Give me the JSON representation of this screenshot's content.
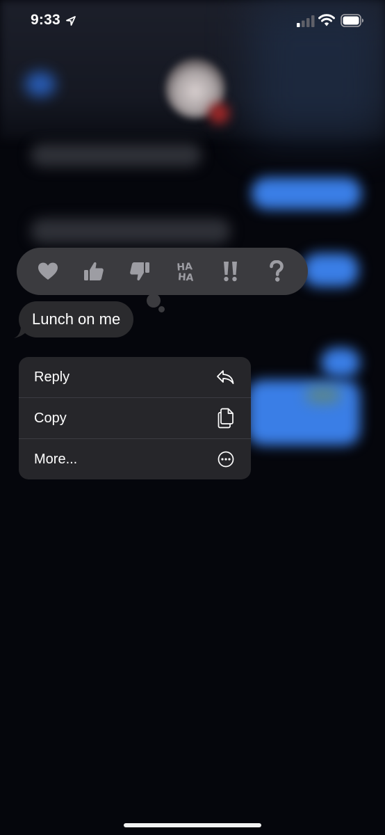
{
  "status_bar": {
    "time": "9:33",
    "icons": [
      "location-arrow-icon",
      "cellular-signal-icon",
      "wifi-icon",
      "battery-icon"
    ]
  },
  "reactions": [
    {
      "name": "heart",
      "icon": "heart-icon"
    },
    {
      "name": "thumbs-up",
      "icon": "thumbs-up-icon"
    },
    {
      "name": "thumbs-down",
      "icon": "thumbs-down-icon"
    },
    {
      "name": "haha",
      "icon": "haha-icon",
      "lines": [
        "HA",
        "HA"
      ]
    },
    {
      "name": "exclamation",
      "icon": "double-exclamation-icon"
    },
    {
      "name": "question",
      "icon": "question-icon"
    }
  ],
  "message": {
    "text": "Lunch on me"
  },
  "context_menu": {
    "items": [
      {
        "label": "Reply",
        "icon": "reply-arrow-icon"
      },
      {
        "label": "Copy",
        "icon": "copy-documents-icon"
      },
      {
        "label": "More...",
        "icon": "more-ellipsis-circle-icon"
      }
    ]
  },
  "colors": {
    "background": "#05060c",
    "menu_background": "#26262a",
    "reaction_bar": "#3b3b3f",
    "bubble": "#2b2b2e",
    "blurred_blue": "#3a7ee6"
  }
}
